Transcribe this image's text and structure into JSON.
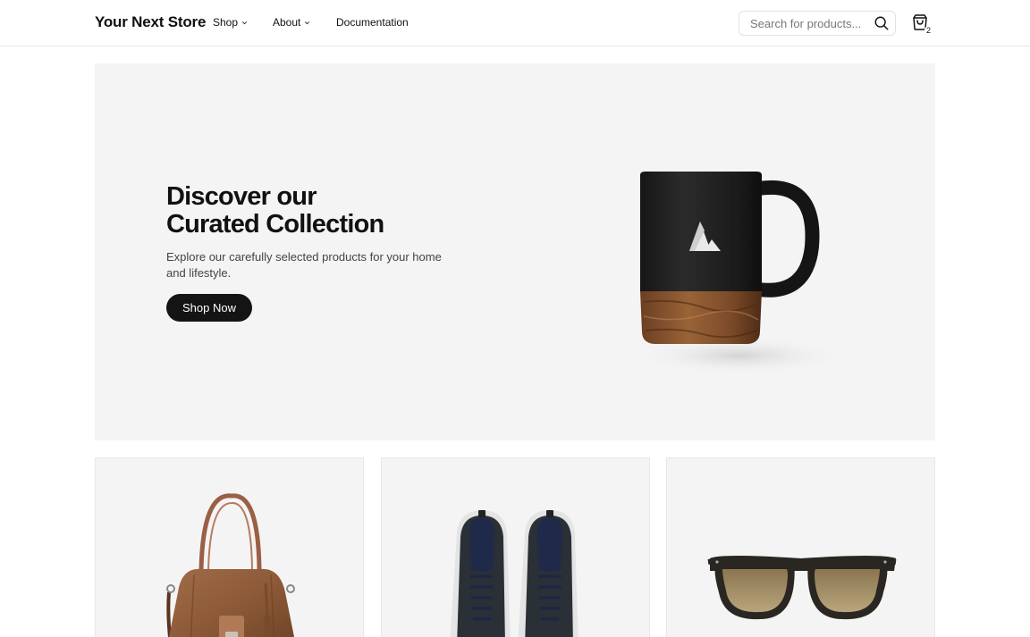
{
  "header": {
    "logo": "Your Next Store",
    "nav": [
      {
        "label": "Shop"
      },
      {
        "label": "About"
      },
      {
        "label": "Documentation"
      }
    ],
    "search": {
      "placeholder": "Search for products...",
      "value": ""
    },
    "cart": {
      "count": "2"
    }
  },
  "hero": {
    "title_line1": "Discover our",
    "title_line2": "Curated Collection",
    "description": "Explore our carefully selected products for your home and lifestyle.",
    "button": "Shop Now"
  },
  "products": [
    {
      "image": "brown-leather-handbag"
    },
    {
      "image": "dark-knit-sneakers"
    },
    {
      "image": "brown-lens-sunglasses"
    }
  ],
  "colors": {
    "text": "#111111",
    "hero_bg": "#f4f4f4",
    "button_bg": "#141414",
    "button_text": "#ffffff"
  }
}
